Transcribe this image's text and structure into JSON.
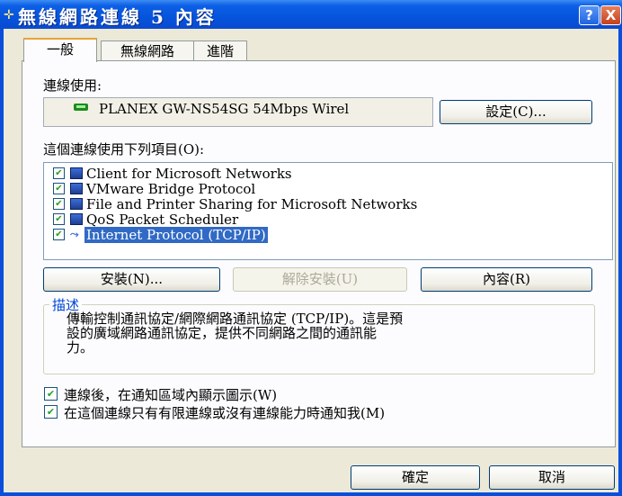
{
  "window": {
    "title": "無線網路連線 5 內容",
    "help_label": "?",
    "close_label": "X"
  },
  "tabs": [
    {
      "label": "一般",
      "active": true
    },
    {
      "label": "無線網路",
      "active": false
    },
    {
      "label": "進階",
      "active": false
    }
  ],
  "general": {
    "connect_using_label": "連線使用:",
    "adapter_name": "PLANEX GW-NS54SG 54Mbps Wirel",
    "configure_label": "設定(C)...",
    "configure_key": "C",
    "items_label": "這個連線使用下列項目(O):",
    "items_key": "O",
    "items": [
      {
        "label": "Client for Microsoft Networks",
        "checked": true,
        "icon": "network-client-icon",
        "selected": false
      },
      {
        "label": "VMware Bridge Protocol",
        "checked": true,
        "icon": "network-service-icon",
        "selected": false
      },
      {
        "label": "File and Printer Sharing for Microsoft Networks",
        "checked": true,
        "icon": "network-service-icon",
        "selected": false
      },
      {
        "label": "QoS Packet Scheduler",
        "checked": true,
        "icon": "network-service-icon",
        "selected": false
      },
      {
        "label": "Internet Protocol (TCP/IP)",
        "checked": true,
        "icon": "protocol-icon",
        "selected": true
      }
    ],
    "install_label": "安裝(N)...",
    "uninstall_label": "解除安裝(U)",
    "properties_label": "內容(R)",
    "description_title": "描述",
    "description_line1": "傳輸控制通訊協定/網際網路通訊協定 (TCP/IP)。這是預",
    "description_line2": "設的廣域網路通訊協定，提供不同網路之間的通訊能",
    "description_line3": "力。",
    "show_icon_label": "連線後，在通知區域內顯示圖示(W)",
    "show_icon_checked": true,
    "notify_label": "在這個連線只有有限連線或沒有連線能力時通知我(M)",
    "notify_checked": true
  },
  "footer": {
    "ok_label": "確定",
    "cancel_label": "取消"
  },
  "colors": {
    "titlebar": "#0654dc",
    "selection": "#316ac5",
    "group_title": "#0046d5",
    "check_mark": "#21a121",
    "dialog_bg": "#ece9d8"
  }
}
